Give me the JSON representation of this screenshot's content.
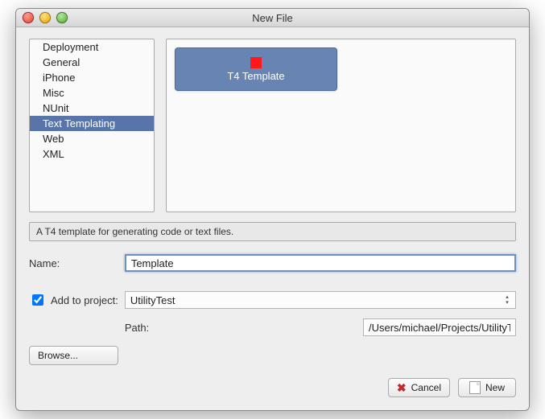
{
  "window": {
    "title": "New File"
  },
  "categories": [
    {
      "label": "Deployment",
      "selected": false
    },
    {
      "label": "General",
      "selected": false
    },
    {
      "label": "iPhone",
      "selected": false
    },
    {
      "label": "Misc",
      "selected": false
    },
    {
      "label": "NUnit",
      "selected": false
    },
    {
      "label": "Text Templating",
      "selected": true
    },
    {
      "label": "Web",
      "selected": false
    },
    {
      "label": "XML",
      "selected": false
    }
  ],
  "tiles": {
    "t4": {
      "label": "T4 Template"
    }
  },
  "description": "A T4 template for generating code or text files.",
  "form": {
    "name_label": "Name:",
    "name_value": "Template",
    "addproj_label": "Add to project:",
    "addproj_checked": true,
    "project_value": "UtilityTest",
    "path_label": "Path:",
    "path_value": "/Users/michael/Projects/UtilityTest/UtilityTest",
    "browse_label": "Browse..."
  },
  "buttons": {
    "cancel": "Cancel",
    "new": "New"
  }
}
